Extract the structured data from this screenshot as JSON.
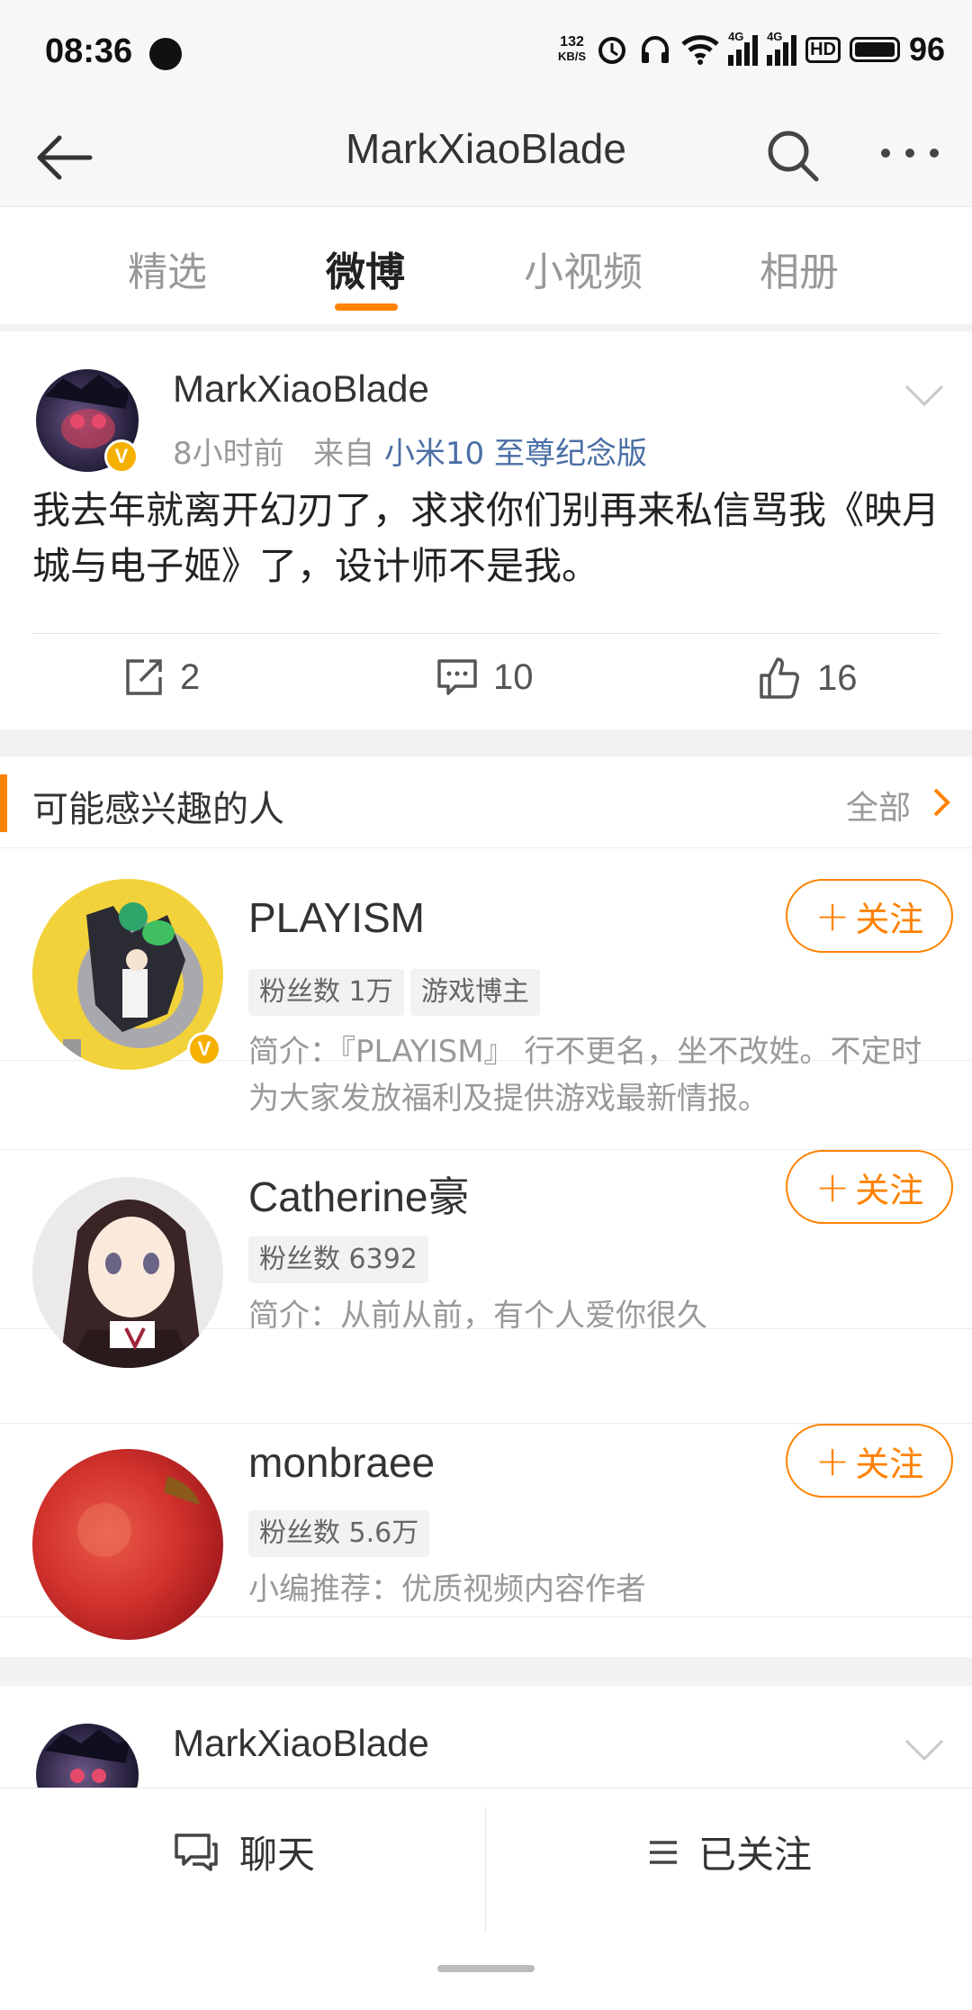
{
  "status_bar": {
    "time": "08:36",
    "net_speed_value": "132",
    "net_speed_unit": "KB/S",
    "signal1_label": "4G",
    "signal2_label": "4G",
    "hd_label": "HD",
    "battery": "96"
  },
  "header": {
    "title": "MarkXiaoBlade",
    "back_icon": "back-arrow-icon",
    "search_icon": "search-icon",
    "more_icon": "more-icon"
  },
  "tabs": [
    {
      "label": "精选",
      "active": false
    },
    {
      "label": "微博",
      "active": true
    },
    {
      "label": "小视频",
      "active": false
    },
    {
      "label": "相册",
      "active": false
    }
  ],
  "post": {
    "author": "MarkXiaoBlade",
    "verified_badge": "V",
    "time_ago": "8小时前",
    "source_prefix": "来自",
    "source": "小米10 至尊纪念版",
    "text": "我去年就离开幻刃了，求求你们别再来私信骂我《映月城与电子姬》了，设计师不是我。",
    "reposts": "2",
    "comments": "10",
    "likes": "16"
  },
  "recommendations": {
    "title": "可能感兴趣的人",
    "all_label": "全部",
    "follow_label": "关注",
    "items": [
      {
        "name": "PLAYISM",
        "tags": [
          "粉丝数 1万",
          "游戏博主"
        ],
        "desc": "简介：『PLAYISM』 行不更名，坐不改姓。不定时为大家发放福利及提供游戏最新情报。",
        "verified_badge": "V"
      },
      {
        "name": "Catherine豪",
        "tags": [
          "粉丝数 6392"
        ],
        "desc": "简介：从前从前，有个人爱你很久"
      },
      {
        "name": "monbraee",
        "tags": [
          "粉丝数 5.6万"
        ],
        "desc": "小编推荐：优质视频内容作者"
      }
    ]
  },
  "post2": {
    "author": "MarkXiaoBlade"
  },
  "bottom_bar": {
    "chat_label": "聊天",
    "following_label": "已关注"
  },
  "colors": {
    "accent": "#ff8200",
    "link": "#4a6fa5",
    "verified": "#f5b000"
  }
}
